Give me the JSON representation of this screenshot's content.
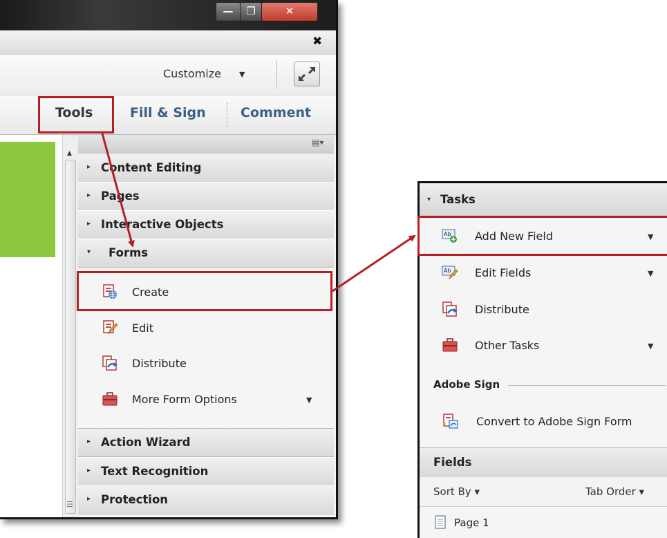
{
  "window": {
    "caption_buttons": {
      "minimize": "—",
      "maximize": "❐",
      "close": "✕"
    },
    "doc_close": "✖",
    "toolbar": {
      "customize_label": "Customize",
      "customize_caret": "▼"
    },
    "tabs": {
      "tools": "Tools",
      "fill_sign": "Fill & Sign",
      "comment": "Comment"
    },
    "panel": {
      "menu_icon": "▤▾",
      "sections": [
        {
          "label": "Content Editing",
          "arrow": "▸"
        },
        {
          "label": "Pages",
          "arrow": "▸"
        },
        {
          "label": "Interactive Objects",
          "arrow": "▸"
        },
        {
          "label": "Forms",
          "arrow": "▾"
        }
      ],
      "forms_items": [
        {
          "label": "Create",
          "icon": "create-form-icon"
        },
        {
          "label": "Edit",
          "icon": "edit-form-icon"
        },
        {
          "label": "Distribute",
          "icon": "distribute-icon"
        },
        {
          "label": "More Form Options",
          "icon": "toolbox-icon",
          "dropdown": "▼"
        }
      ],
      "lower_sections": [
        {
          "label": "Action Wizard",
          "arrow": "▸"
        },
        {
          "label": "Text Recognition",
          "arrow": "▸"
        },
        {
          "label": "Protection",
          "arrow": "▸"
        }
      ]
    },
    "scrollbar": {
      "up": "▲",
      "grip": "☰"
    }
  },
  "zoom_panel": {
    "tasks_header": {
      "label": "Tasks",
      "arrow": "▾"
    },
    "items": [
      {
        "label": "Add New Field",
        "icon": "add-field-icon",
        "dropdown": "▼"
      },
      {
        "label": "Edit Fields",
        "icon": "edit-fields-icon",
        "dropdown": "▼"
      },
      {
        "label": "Distribute",
        "icon": "distribute-icon"
      },
      {
        "label": "Other Tasks",
        "icon": "toolbox-icon",
        "dropdown": "▼"
      }
    ],
    "adobe_sign": {
      "label": "Adobe Sign",
      "item": "Convert to Adobe Sign Form"
    },
    "fields": {
      "header": "Fields",
      "sort_by": "Sort By ▾",
      "tab_order": "Tab Order ▾",
      "page": "Page 1"
    }
  },
  "colors": {
    "highlight": "#b41f24",
    "tab_blue": "#3b5e86",
    "green": "#8dc63f"
  }
}
